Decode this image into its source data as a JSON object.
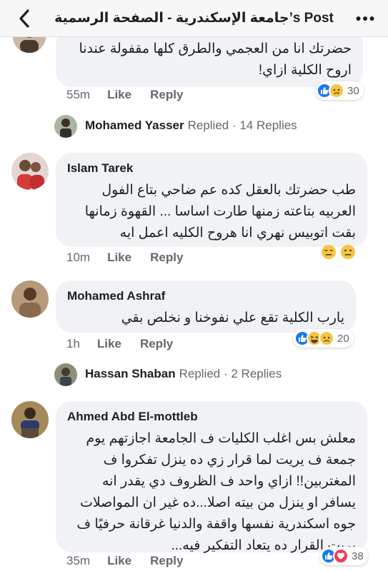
{
  "header": {
    "title": "جامعة الإسكندرية - الصفحة الرسمية’s Post"
  },
  "comments": [
    {
      "lines": [
        "حضرتك انا من العجمي والطرق كلها مقفولة عندنا",
        "اروح الكلية ازاي!"
      ],
      "time": "55m",
      "like": "Like",
      "reply": "Reply",
      "reaction_count": "30"
    },
    {
      "author": "Islam Tarek",
      "lines": [
        "طب حضرتك بالعقل كده عم ضاحي بتاع الفول",
        "العربيه بتاعته زمنها طارت اساسا ... القهوة زمانها",
        "بقت اتوبيس نهري انا هروح الكليه اعمل ايه"
      ],
      "time": "10m",
      "like": "Like",
      "reply": "Reply"
    },
    {
      "author": "Mohamed Ashraf",
      "lines": [
        "يارب الكلية تقع علي نفوخنا و نخلص بقي"
      ],
      "time": "1h",
      "like": "Like",
      "reply": "Reply",
      "reaction_count": "20"
    },
    {
      "author": "Ahmed Abd El-mottleb",
      "lines": [
        "معلش بس اغلب الكليات ف الجامعة اجازتهم يوم",
        "جمعة ف يريت لما قرار زي ده ينزل تفكروا ف",
        "المغتربين!! ازاي واحد ف الظروف دي يقدر انه",
        "يسافر او ينزل من بيته اصلا...ده غير ان المواصلات",
        "جوه اسكندرية نفسها واقفة والدنيا غرقانة حرفيًا ف",
        "يريت القرار ده يتعاد التفكير فيه..."
      ],
      "time": "35m",
      "like": "Like",
      "reply": "Reply",
      "reaction_count": "38"
    }
  ],
  "replied": [
    {
      "name": "Mohamed Yasser",
      "rest": "Replied · 14 Replies"
    },
    {
      "name": "Hassan Shaban",
      "rest": "Replied · 2 Replies"
    }
  ],
  "colors": {
    "like_blue": "#1877f2",
    "love_red": "#f33e58",
    "emoji_yellow": "#f7c543",
    "bubble": "#f0f2f5"
  }
}
